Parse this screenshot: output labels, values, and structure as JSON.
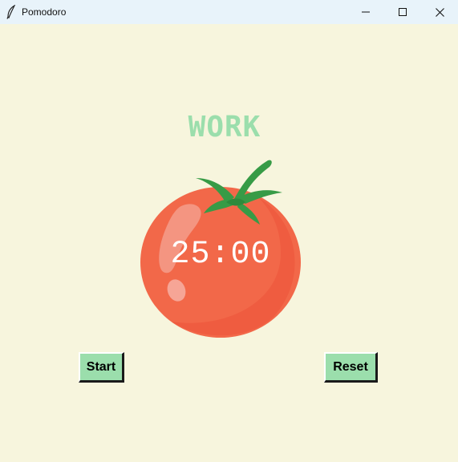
{
  "window": {
    "title": "Pomodoro",
    "app_icon": "feather-icon",
    "controls": [
      "minimize-icon",
      "maximize-icon",
      "close-icon"
    ]
  },
  "main": {
    "mode_label": "WORK",
    "timer": "25:00",
    "start_label": "Start",
    "reset_label": "Reset"
  },
  "colors": {
    "background": "#f7f5dd",
    "accent_green": "#9bdeac",
    "tomato_red": "#f26849",
    "leaf_green": "#379b46",
    "titlebar": "#e8f3fa"
  },
  "icons": {
    "tomato": "tomato-image"
  }
}
